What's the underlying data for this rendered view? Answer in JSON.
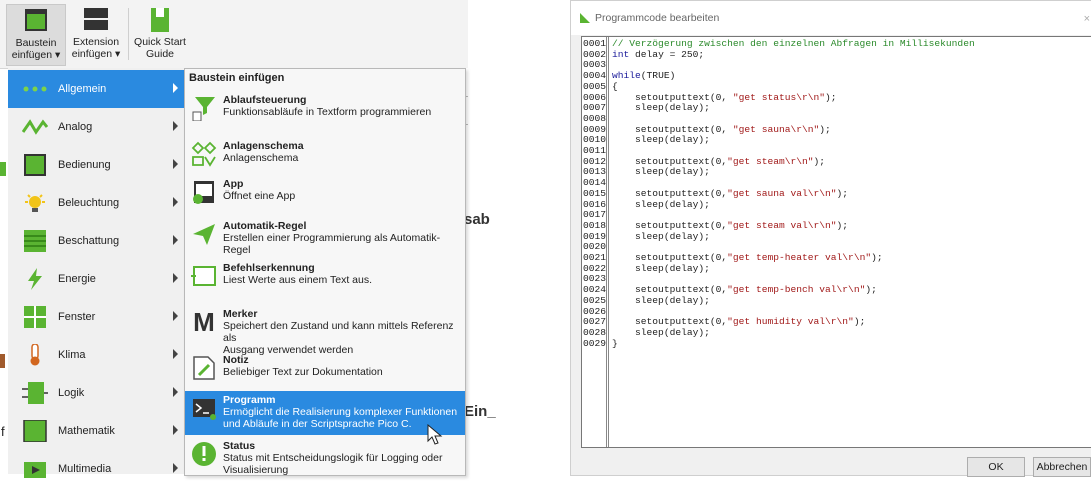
{
  "ribbon": {
    "buttons": [
      {
        "line1": "Baustein",
        "line2": "einfügen ▾"
      },
      {
        "line1": "Extension",
        "line2": "einfügen ▾"
      },
      {
        "line1": "Quick Start",
        "line2": "Guide"
      }
    ]
  },
  "categories": [
    "Allgemein",
    "Analog",
    "Bedienung",
    "Beleuchtung",
    "Beschattung",
    "Energie",
    "Fenster",
    "Klima",
    "Logik",
    "Mathematik",
    "Multimedia"
  ],
  "background_fragments": {
    "sab": "sab",
    "ein": "Ein_",
    "f": "f"
  },
  "submenu": {
    "header": "Baustein einfügen",
    "items": [
      {
        "title": "Ablaufsteuerung",
        "desc": [
          "Funktionsabläufe in Textform programmieren"
        ]
      },
      {
        "title": "Anlagenschema",
        "desc": [
          "Anlagenschema"
        ]
      },
      {
        "title": "App",
        "desc": [
          "Öffnet eine App"
        ]
      },
      {
        "title": "Automatik-Regel",
        "desc": [
          "Erstellen einer Programmierung als Automatik-Regel"
        ]
      },
      {
        "title": "Befehlserkennung",
        "desc": [
          "Liest Werte aus einem Text aus."
        ]
      },
      {
        "title": "Merker",
        "desc": [
          "Speichert den Zustand und kann mittels Referenz als",
          "Ausgang verwendet werden"
        ]
      },
      {
        "title": "Notiz",
        "desc": [
          "Beliebiger Text zur Dokumentation"
        ]
      },
      {
        "title": "Programm",
        "desc": [
          "Ermöglicht die Realisierung komplexer Funktionen",
          "und Abläufe in der Scriptsprache Pico C."
        ]
      },
      {
        "title": "Status",
        "desc": [
          "Status mit Entscheidungslogik für Logging oder",
          "Visualisierung"
        ]
      }
    ]
  },
  "dialog": {
    "title": "Programmcode bearbeiten",
    "close": "×",
    "ok": "OK",
    "cancel": "Abbrechen",
    "lines": [
      {
        "n": "0001",
        "t": "// Verzögerung zwischen den einzelnen Abfragen in Millisekunden"
      },
      {
        "n": "0002",
        "t": "int delay = 250;"
      },
      {
        "n": "0003",
        "t": ""
      },
      {
        "n": "0004",
        "t": "while(TRUE)"
      },
      {
        "n": "0005",
        "t": "{"
      },
      {
        "n": "0006",
        "t": "    setoutputtext(0, \"get status\\r\\n\");"
      },
      {
        "n": "0007",
        "t": "    sleep(delay);"
      },
      {
        "n": "0008",
        "t": ""
      },
      {
        "n": "0009",
        "t": "    setoutputtext(0, \"get sauna\\r\\n\");"
      },
      {
        "n": "0010",
        "t": "    sleep(delay);"
      },
      {
        "n": "0011",
        "t": ""
      },
      {
        "n": "0012",
        "t": "    setoutputtext(0,\"get steam\\r\\n\");"
      },
      {
        "n": "0013",
        "t": "    sleep(delay);"
      },
      {
        "n": "0014",
        "t": ""
      },
      {
        "n": "0015",
        "t": "    setoutputtext(0,\"get sauna val\\r\\n\");"
      },
      {
        "n": "0016",
        "t": "    sleep(delay);"
      },
      {
        "n": "0017",
        "t": ""
      },
      {
        "n": "0018",
        "t": "    setoutputtext(0,\"get steam val\\r\\n\");"
      },
      {
        "n": "0019",
        "t": "    sleep(delay);"
      },
      {
        "n": "0020",
        "t": ""
      },
      {
        "n": "0021",
        "t": "    setoutputtext(0,\"get temp-heater val\\r\\n\");"
      },
      {
        "n": "0022",
        "t": "    sleep(delay);"
      },
      {
        "n": "0023",
        "t": ""
      },
      {
        "n": "0024",
        "t": "    setoutputtext(0,\"get temp-bench val\\r\\n\");"
      },
      {
        "n": "0025",
        "t": "    sleep(delay);"
      },
      {
        "n": "0026",
        "t": ""
      },
      {
        "n": "0027",
        "t": "    setoutputtext(0,\"get humidity val\\r\\n\");"
      },
      {
        "n": "0028",
        "t": "    sleep(delay);"
      },
      {
        "n": "0029",
        "t": "}"
      }
    ]
  },
  "colors": {
    "accent": "#2a8ae0",
    "comment": "#2b8a2b",
    "keyword": "#1a1a9a",
    "string": "#a11a1a"
  }
}
